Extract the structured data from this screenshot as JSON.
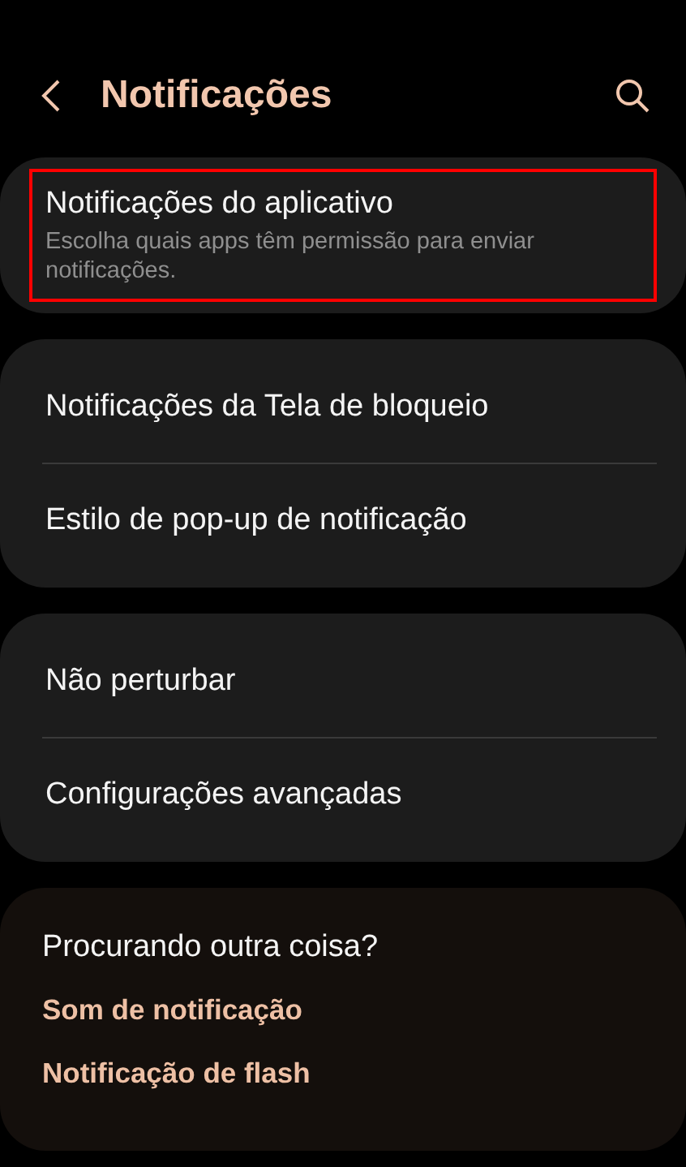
{
  "header": {
    "title": "Notificações"
  },
  "groups": [
    {
      "items": [
        {
          "title": "Notificações do aplicativo",
          "subtitle": "Escolha quais apps têm permissão para enviar notificações.",
          "highlighted": true
        }
      ]
    },
    {
      "items": [
        {
          "title": "Notificações da Tela de bloqueio",
          "highlighted": false
        },
        {
          "title": "Estilo de pop-up de notificação",
          "highlighted": false
        }
      ]
    },
    {
      "items": [
        {
          "title": "Não perturbar",
          "highlighted": false
        },
        {
          "title": "Configurações avançadas",
          "highlighted": false
        }
      ]
    }
  ],
  "suggestions": {
    "title": "Procurando outra coisa?",
    "links": [
      "Som de notificação",
      "Notificação de flash"
    ]
  }
}
